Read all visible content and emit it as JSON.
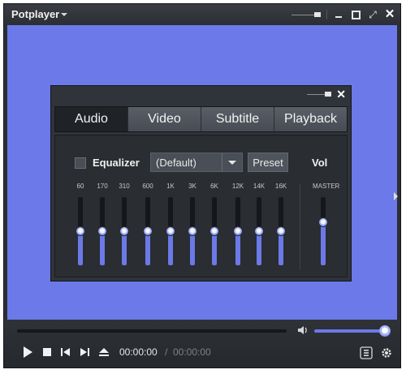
{
  "window": {
    "title": "Potplayer"
  },
  "colors": {
    "video_bg": "#6b7ae8",
    "accent": "#6b7ae8",
    "panel": "#30343a"
  },
  "dialog": {
    "tabs": [
      {
        "label": "Audio",
        "active": true
      },
      {
        "label": "Video",
        "active": false
      },
      {
        "label": "Subtitle",
        "active": false
      },
      {
        "label": "Playback",
        "active": false
      }
    ],
    "equalizer": {
      "label": "Equalizer",
      "checked": false,
      "preset_value": "(Default)",
      "preset_button": "Preset",
      "vol_label": "Vol",
      "master_label": "MASTER",
      "bands": [
        {
          "label": "60",
          "level": 0.5
        },
        {
          "label": "170",
          "level": 0.5
        },
        {
          "label": "310",
          "level": 0.5
        },
        {
          "label": "600",
          "level": 0.5
        },
        {
          "label": "1K",
          "level": 0.5
        },
        {
          "label": "3K",
          "level": 0.5
        },
        {
          "label": "6K",
          "level": 0.5
        },
        {
          "label": "12K",
          "level": 0.5
        },
        {
          "label": "14K",
          "level": 0.5
        },
        {
          "label": "16K",
          "level": 0.5
        }
      ],
      "master_level": 0.63
    }
  },
  "controls": {
    "current_time": "00:00:00",
    "separator": "/",
    "duration": "00:00:00",
    "volume_level": 1.0,
    "seek_level": 0
  },
  "icons": [
    "dropdown-caret-icon",
    "minimize-icon",
    "maximize-icon",
    "fullscreen-icon",
    "close-icon",
    "play-icon",
    "stop-icon",
    "previous-icon",
    "next-icon",
    "eject-icon",
    "speaker-icon",
    "playlist-icon",
    "settings-icon"
  ]
}
